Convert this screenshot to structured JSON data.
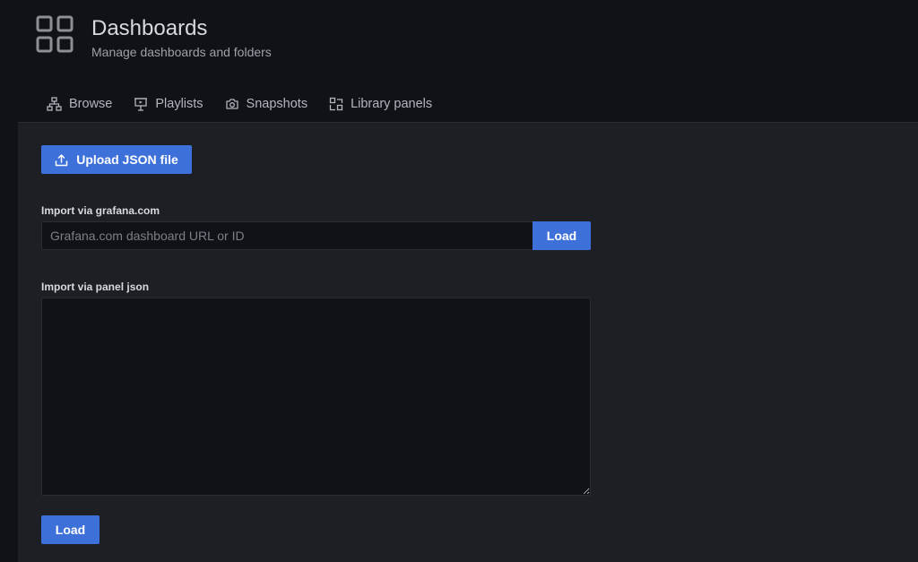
{
  "header": {
    "title": "Dashboards",
    "subtitle": "Manage dashboards and folders",
    "icon": "apps-grid-icon"
  },
  "tabs": [
    {
      "label": "Browse",
      "icon": "sitemap-icon"
    },
    {
      "label": "Playlists",
      "icon": "presentation-icon"
    },
    {
      "label": "Snapshots",
      "icon": "camera-icon"
    },
    {
      "label": "Library panels",
      "icon": "library-panel-icon"
    }
  ],
  "import": {
    "upload_label": "Upload JSON file",
    "grafana_label": "Import via grafana.com",
    "grafana_placeholder": "Grafana.com dashboard URL or ID",
    "grafana_value": "",
    "grafana_load_label": "Load",
    "json_label": "Import via panel json",
    "json_value": "",
    "json_load_label": "Load"
  },
  "colors": {
    "accent": "#3d71d9",
    "background": "#111217",
    "panel": "#1e1f24"
  }
}
